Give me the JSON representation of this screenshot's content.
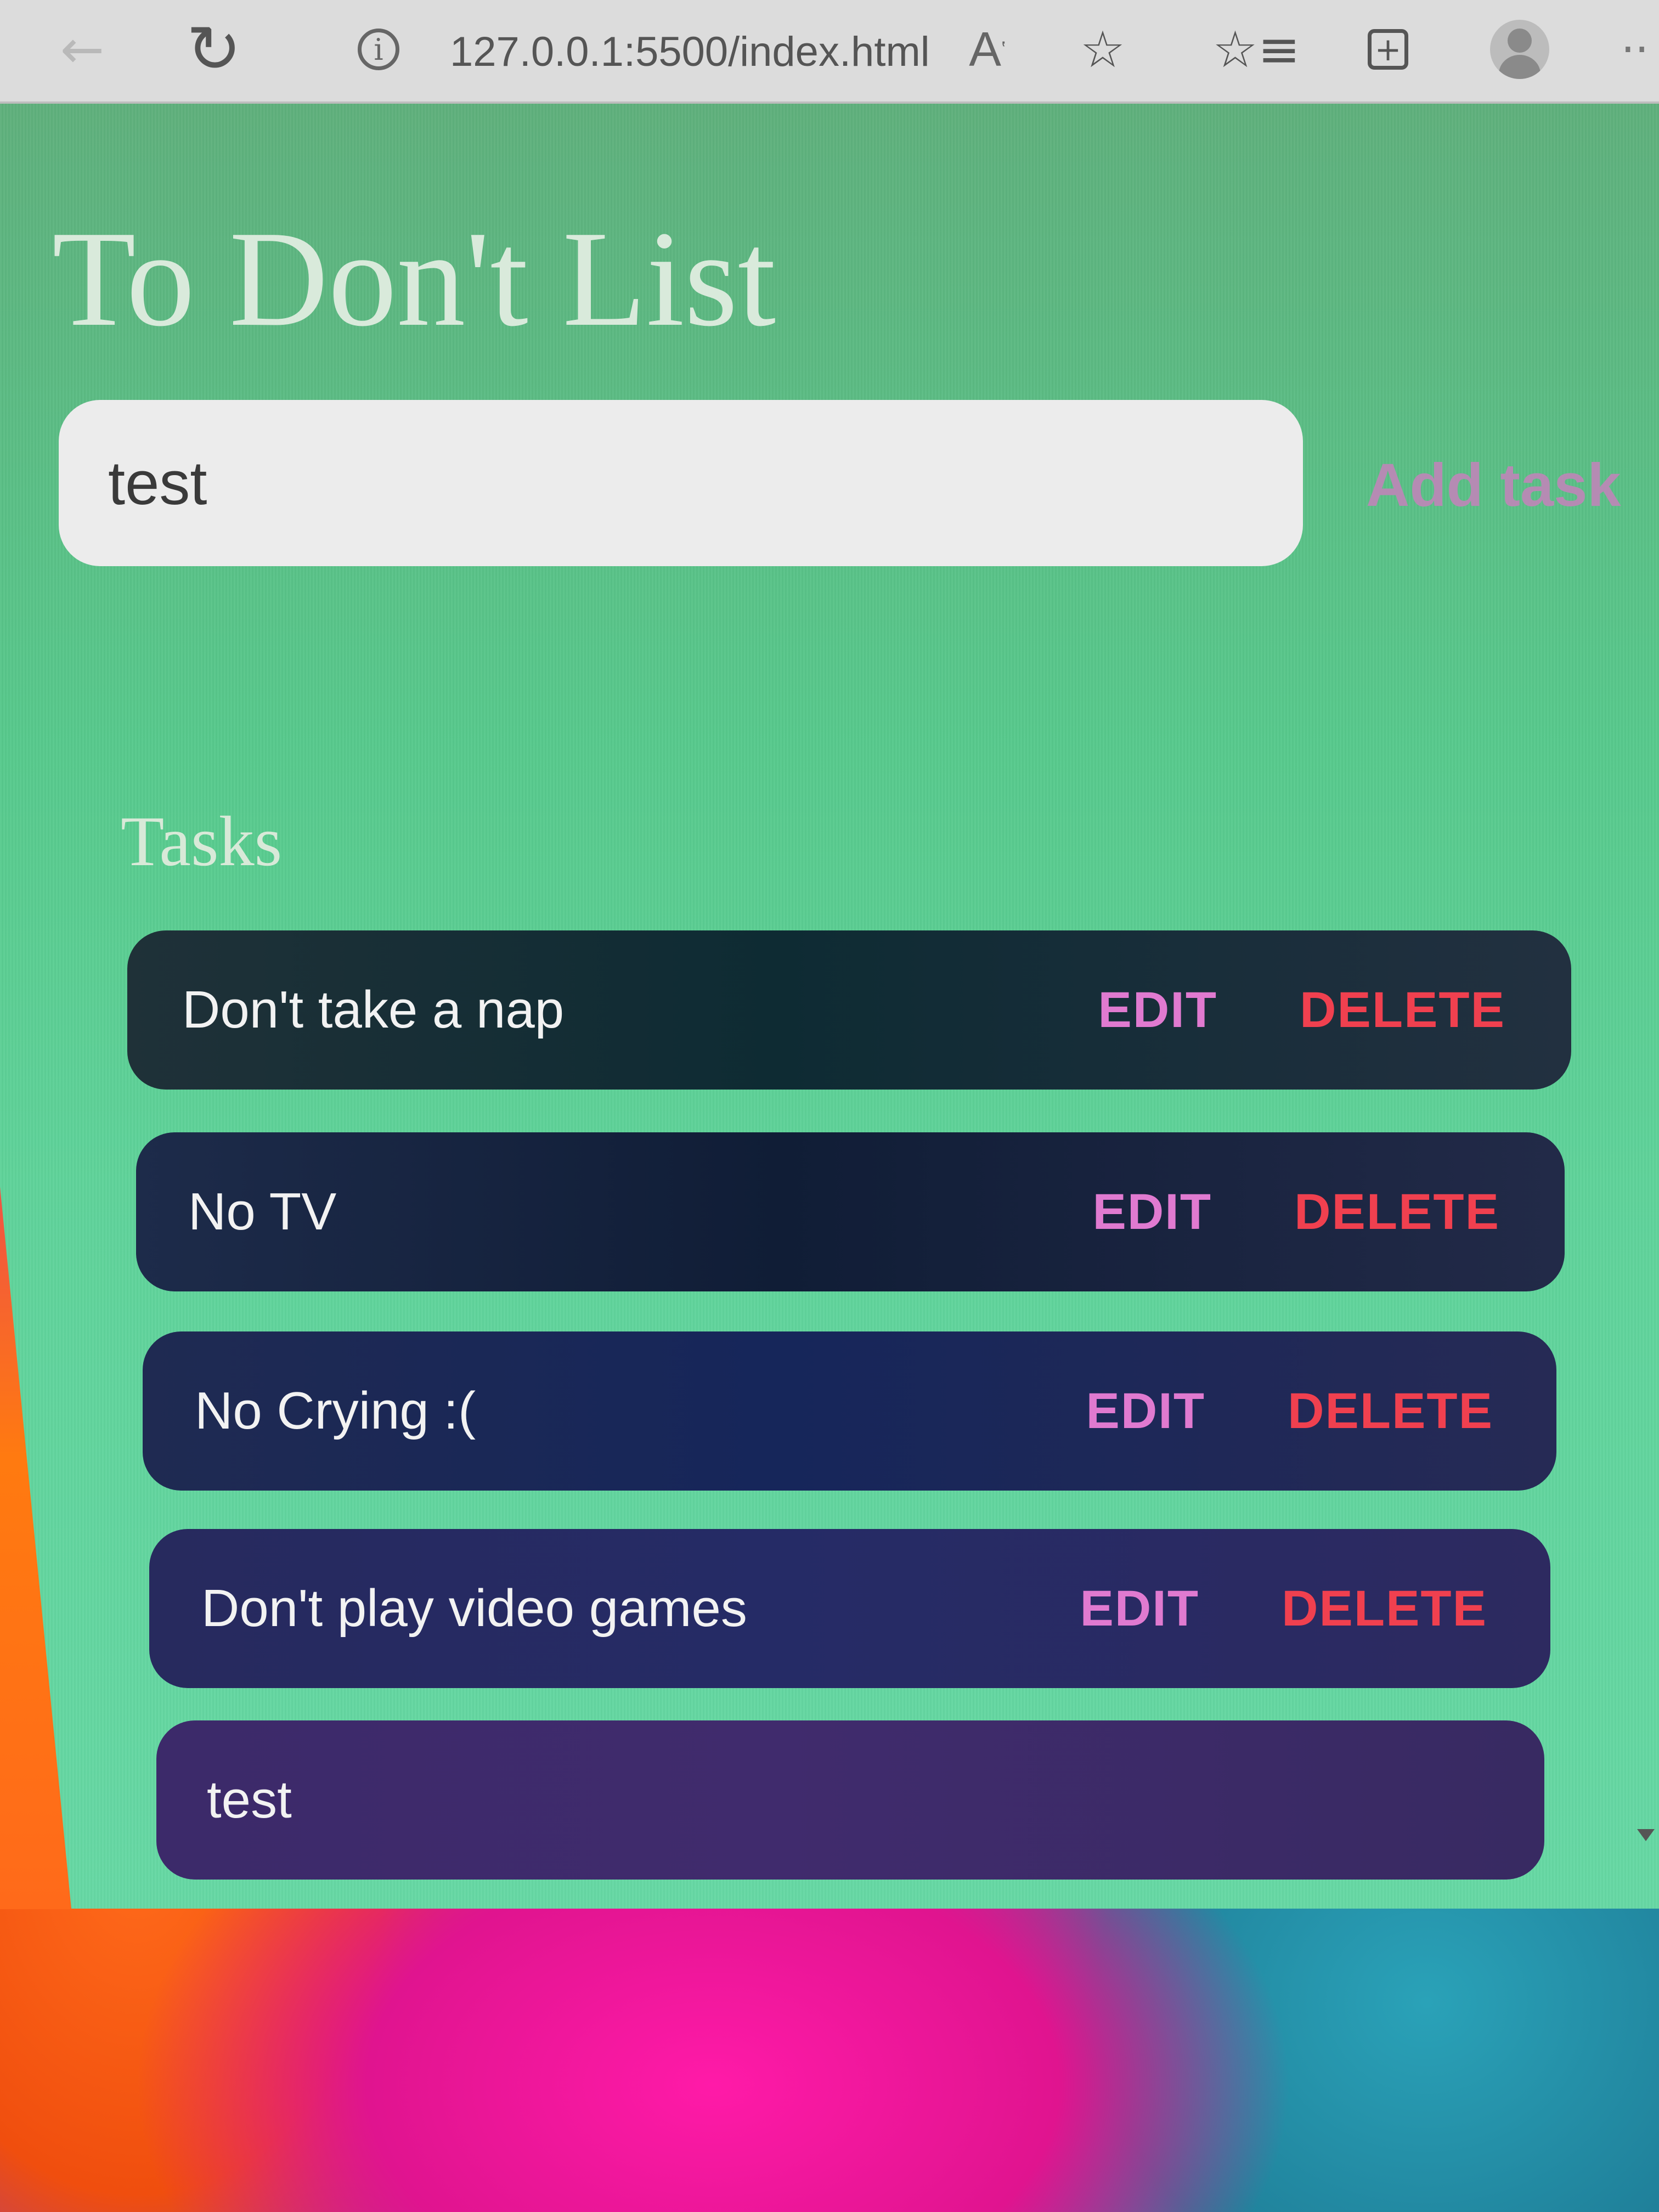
{
  "browser": {
    "url": "127.0.0.1:5500/index.html",
    "read_aloud_label": "A",
    "icons": {
      "back": "back-arrow-icon",
      "reload": "reload-icon",
      "site_info": "info-icon",
      "read_aloud": "read-aloud-icon",
      "add_favorite": "star-plus-icon",
      "favorites": "favorites-list-icon",
      "collections": "collections-icon",
      "profile": "profile-avatar-icon",
      "more": "more-icon"
    }
  },
  "page": {
    "title": "To Don't List",
    "input_value": "test",
    "add_button_label": "Add task",
    "tasks_heading": "Tasks"
  },
  "tasks": [
    {
      "text": "Don't take a nap",
      "edit_label": "EDIT",
      "delete_label": "DELETE"
    },
    {
      "text": "No TV",
      "edit_label": "EDIT",
      "delete_label": "DELETE"
    },
    {
      "text": "No Crying :(",
      "edit_label": "EDIT",
      "delete_label": "DELETE"
    },
    {
      "text": "Don't play video games",
      "edit_label": "EDIT",
      "delete_label": "DELETE"
    },
    {
      "text": "test"
    }
  ],
  "colors": {
    "page_background": "#57c98c",
    "title_text": "#d9eadb",
    "edit_text": "#e07ad0",
    "delete_text": "#f0404f",
    "add_task_text": "#b58bb3",
    "input_background": "#ececec"
  }
}
